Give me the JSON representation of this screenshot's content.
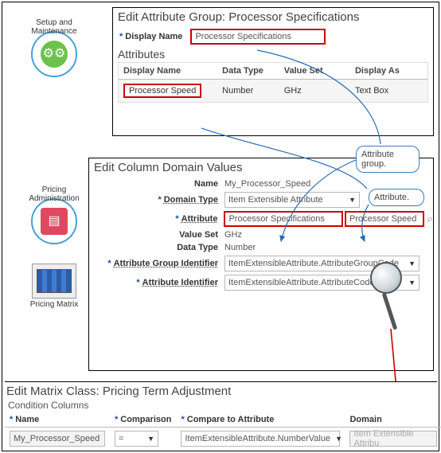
{
  "badges": {
    "setup": "Setup and Maintenance",
    "pricing_admin": "Pricing Administration",
    "pricing_matrix": "Pricing Matrix"
  },
  "top_panel": {
    "title": "Edit Attribute Group: Processor Specifications",
    "display_name_label": "Display Name",
    "display_name_value": "Processor Specifications",
    "attributes_header": "Attributes",
    "cols": {
      "c1": "Display Name",
      "c2": "Data Type",
      "c3": "Value Set",
      "c4": "Display As"
    },
    "row": {
      "c1": "Processor Speed",
      "c2": "Number",
      "c3": "GHz",
      "c4": "Text Box"
    }
  },
  "mid_panel": {
    "title": "Edit Column Domain Values",
    "name_label": "Name",
    "name_value": "My_Processor_Speed",
    "domain_type_label": "Domain Type",
    "domain_type_value": "Item Extensible Attribute",
    "attribute_label": "Attribute",
    "attribute_value1": "Processor Specifications",
    "attribute_value2": "Processor Speed",
    "value_set_label": "Value Set",
    "value_set_value": "GHz",
    "data_type_label": "Data Type",
    "data_type_value": "Number",
    "attr_group_id_label": "Attribute Group Identifier",
    "attr_group_id_value": "ItemExtensibleAttribute.AttributeGroupCode",
    "attr_id_label": "Attribute Identifier",
    "attr_id_value": "ItemExtensibleAttribute.AttributeCode"
  },
  "bubbles": {
    "b1": "Attribute group.",
    "b2": "Attribute."
  },
  "bot_panel": {
    "title": "Edit Matrix Class: Pricing Term Adjustment",
    "subhdr": "Condition Columns",
    "cols": {
      "c1": "Name",
      "c2": "Comparison",
      "c3": "Compare to Attribute",
      "c4": "Domain"
    },
    "row": {
      "name": "My_Processor_Speed",
      "comp": "=",
      "cta": "ItemExtensibleAttribute.NumberValue",
      "domain": "Item Extensible Attribu"
    }
  }
}
